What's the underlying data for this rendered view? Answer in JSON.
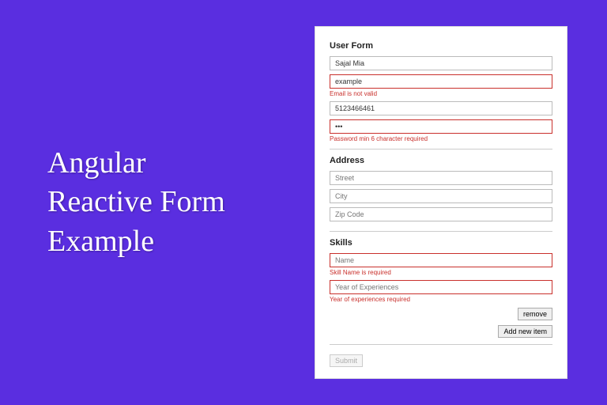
{
  "hero": {
    "title_line1": "Angular",
    "title_line2": "Reactive Form",
    "title_line3": "Example"
  },
  "form": {
    "user": {
      "heading": "User Form",
      "name_value": "Sajal Mia",
      "email_value": "example",
      "email_error": "Email is not valid",
      "phone_value": "5123466461",
      "password_value": "•••",
      "password_error": "Password min 6 character required"
    },
    "address": {
      "heading": "Address",
      "street_placeholder": "Street",
      "city_placeholder": "City",
      "zip_placeholder": "Zip Code"
    },
    "skills": {
      "heading": "Skills",
      "name_placeholder": "Name",
      "name_error": "Skill Name is required",
      "years_placeholder": "Year of Experiences",
      "years_error": "Year of experiences required",
      "remove_label": "remove",
      "add_label": "Add new item"
    },
    "submit_label": "Submit"
  }
}
